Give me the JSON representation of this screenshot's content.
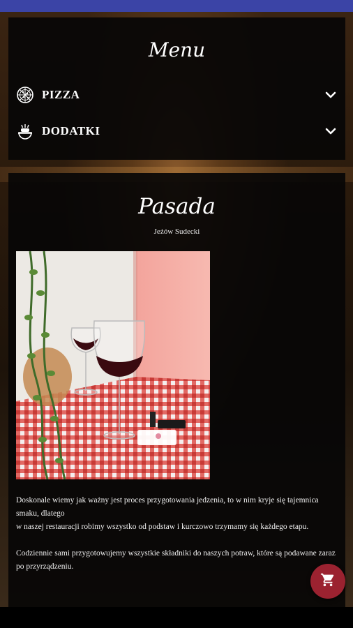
{
  "menu": {
    "title": "Menu",
    "categories": [
      {
        "label": "PIZZA",
        "icon": "pizza-icon"
      },
      {
        "label": "DODATKI",
        "icon": "food-tray-icon"
      }
    ]
  },
  "restaurant": {
    "name": "Pasada",
    "location": "Jeżów Sudecki",
    "description_1": "Doskonale wiemy jak ważny jest proces przygotowania jedzenia, to w nim kryje się tajemnica smaku, dlatego",
    "description_2": "w naszej restauracji robimy wszystko od podstaw i kurczowo trzymamy się każdego etapu.",
    "description_3": "Codziennie sami przygotowujemy wszystkie składniki do naszych potraw, które są podawane zaraz",
    "description_4": "po przyrządzeniu."
  },
  "colors": {
    "status_bar": "#3b44a6",
    "cart_button": "#9b2230",
    "panel": "#080606"
  },
  "cart": {
    "icon": "cart-icon"
  }
}
